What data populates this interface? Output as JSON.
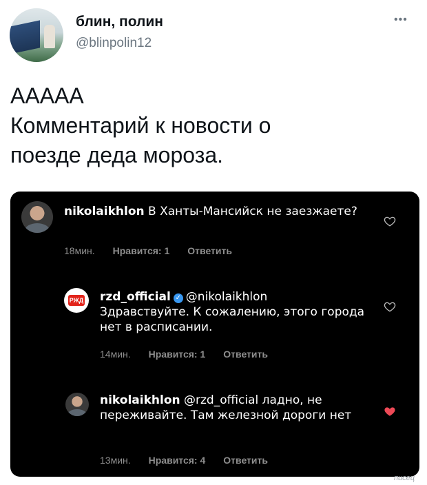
{
  "tweet": {
    "author_name": "блин, полин",
    "author_handle": "@blinpolin12",
    "more_icon": "more-horizontal-icon",
    "text": "ААААА\nКомментарий к новости о\nпоезде деда мороза."
  },
  "comments": [
    {
      "username": "nikolaikhlon",
      "text": " В Ханты-Мансийск не заезжаете?",
      "time": "18мин.",
      "likes": "Нравится: 1",
      "reply": "Ответить",
      "liked": false
    },
    {
      "username": "rzd_official",
      "verified_icon": "verified-badge-icon",
      "mention": "@nikolaikhlon",
      "text": "Здравствуйте. К сожалению, этого города нет в расписании.",
      "time": "14мин.",
      "likes": "Нравится: 1",
      "reply": "Ответить",
      "liked": false
    },
    {
      "username": "nikolaikhlon",
      "mention": "@rzd_official",
      "text": " ладно, не переживайте. Там железной дороги нет",
      "time": "13мин.",
      "likes": "Нравится: 4",
      "reply": "Ответить",
      "liked": true
    }
  ],
  "colors": {
    "heart_liked": "#ed4956",
    "heart_outline": "#bbbbbb"
  },
  "watermark": "писец"
}
